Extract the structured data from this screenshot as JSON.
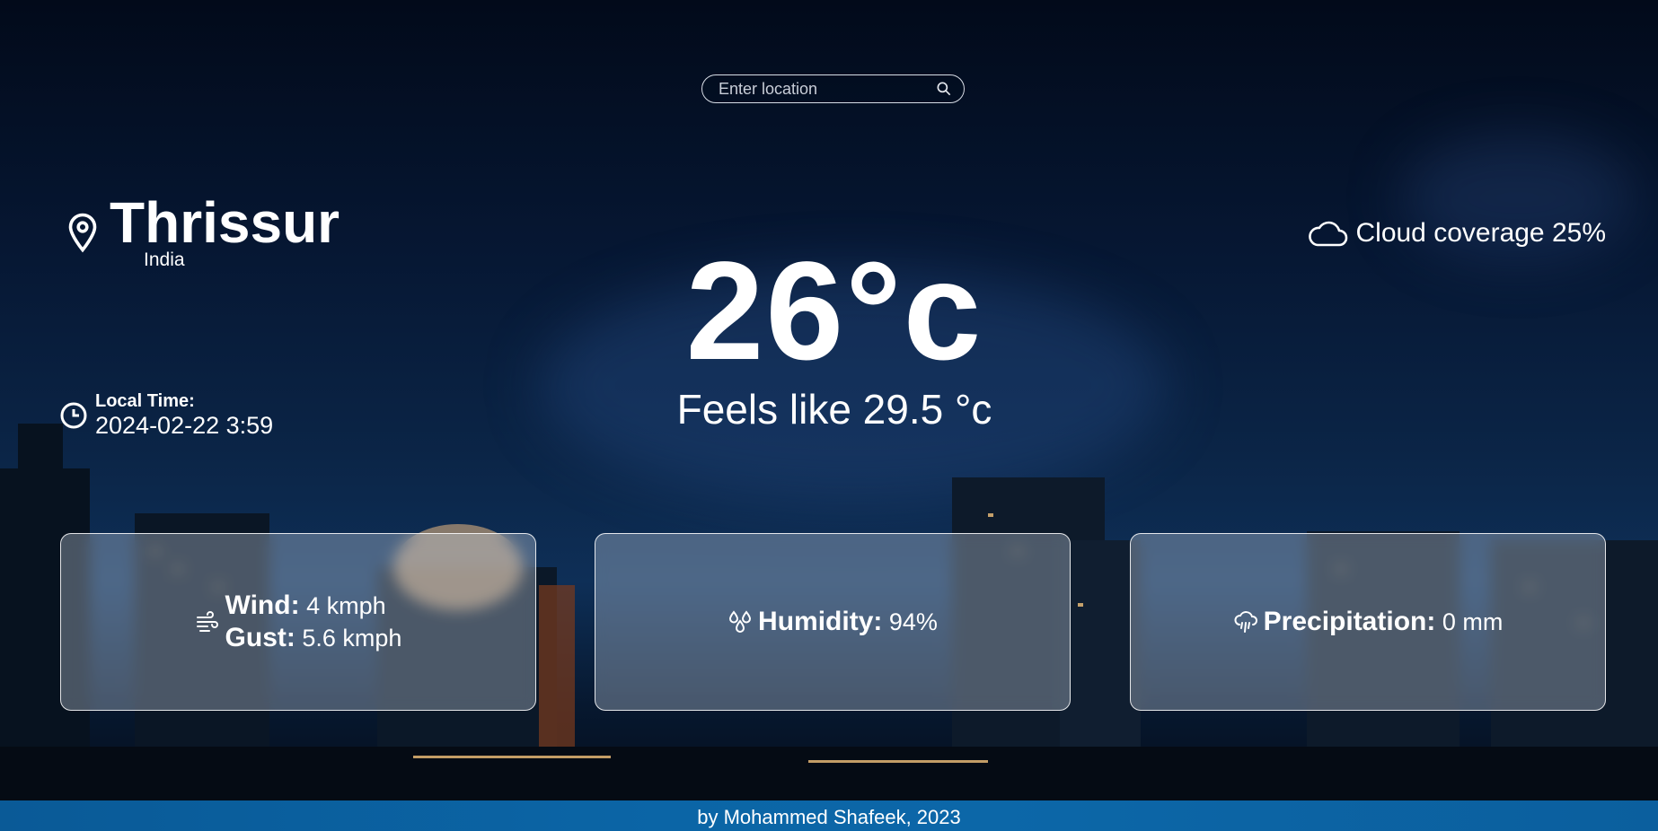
{
  "search": {
    "placeholder": "Enter location",
    "icon": "search-icon"
  },
  "location": {
    "city": "Thrissur",
    "country": "India",
    "icon": "map-pin-icon"
  },
  "weather": {
    "temperature": "26°c",
    "feels_like": "Feels like 29.5 °c",
    "cloud_coverage": "Cloud coverage 25%",
    "cloud_icon": "cloud-icon"
  },
  "local_time": {
    "label": "Local Time:",
    "value": "2024-02-22 3:59",
    "icon": "clock-icon"
  },
  "cards": {
    "wind": {
      "label": "Wind:",
      "value": "4 kmph",
      "gust_label": "Gust:",
      "gust_value": "5.6 kmph",
      "icon": "wind-icon"
    },
    "humidity": {
      "label": "Humidity:",
      "value": "94%",
      "icon": "humidity-icon"
    },
    "precipitation": {
      "label": "Precipitation:",
      "value": "0 mm",
      "icon": "rain-cloud-icon"
    }
  },
  "footer": {
    "text": "by Mohammed Shafeek, 2023"
  },
  "colors": {
    "footer_bg": "#0b65a6",
    "text": "#ffffff"
  }
}
